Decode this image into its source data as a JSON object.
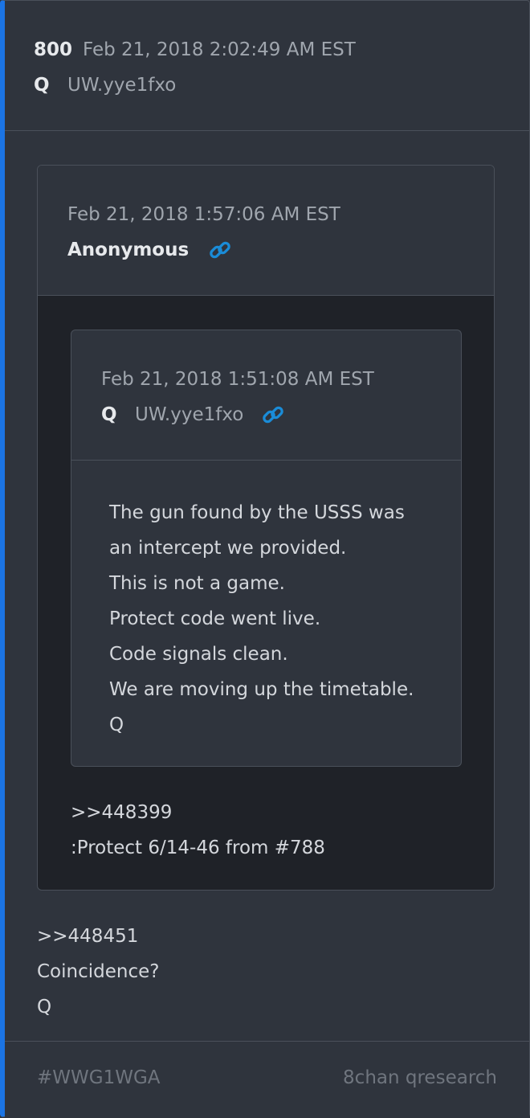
{
  "post": {
    "number": "800",
    "date": "Feb 21, 2018 2:02:49 AM EST",
    "author": "Q",
    "tripcode": "UW.yye1fxo",
    "lines": [
      ">>448451",
      "Coincidence?",
      "Q"
    ]
  },
  "quoted": {
    "date": "Feb 21, 2018 1:57:06 AM EST",
    "author": "Anonymous",
    "lines": [
      ">>448399",
      ":Protect 6/14-46 from #788"
    ]
  },
  "nested_quote": {
    "date": "Feb 21, 2018 1:51:08 AM EST",
    "author": "Q",
    "tripcode": "UW.yye1fxo",
    "lines": [
      "The gun found by the USSS was",
      "an intercept we provided.",
      "This is not a game.",
      "Protect code went live.",
      "Code signals clean.",
      "We are moving up the timetable.",
      "Q"
    ]
  },
  "footer": {
    "tag": "#WWG1WGA",
    "source": "8chan qresearch"
  },
  "icons": {
    "link": "link-icon"
  },
  "colors": {
    "accent": "#1b74e4",
    "link": "#1a8cd8",
    "background": "#2f343d",
    "quote_background": "#1f2228"
  }
}
